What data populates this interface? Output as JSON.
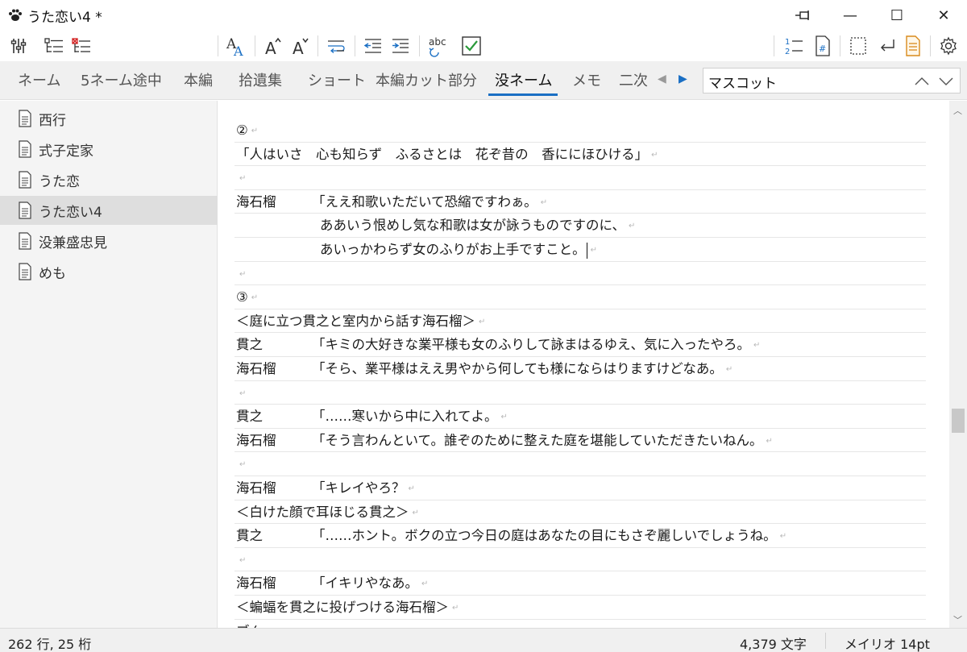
{
  "window": {
    "title": "うた恋い4 *",
    "minimize": "—",
    "maximize": "☐",
    "close": "✕"
  },
  "toolbar": {
    "icons": [
      "settings-tools-icon",
      "outline-view-icon",
      "outline-delete-icon",
      "font-style-icon",
      "font-increase-icon",
      "font-decrease-icon",
      "line-wrap-icon",
      "indent-decrease-icon",
      "indent-increase-icon",
      "spellcheck-icon",
      "check-icon",
      "line-number-icon",
      "page-number-icon",
      "select-box-icon",
      "newline-icon",
      "notes-icon",
      "gear-icon"
    ],
    "font_a": "A",
    "spell_label": "abc"
  },
  "tabs": [
    {
      "label": "ネーム"
    },
    {
      "label": "5ネーム途中"
    },
    {
      "label": "本編"
    },
    {
      "label": "拾遺集"
    },
    {
      "label": "ショート"
    },
    {
      "label": "本編カット部分"
    },
    {
      "label": "没ネーム"
    },
    {
      "label": "メモ"
    },
    {
      "label": "二次"
    }
  ],
  "active_tab": "没ネーム",
  "search": {
    "value": "マスコット"
  },
  "sidebar": {
    "items": [
      {
        "label": "西行"
      },
      {
        "label": "式子定家"
      },
      {
        "label": "うた恋"
      },
      {
        "label": "うた恋い4"
      },
      {
        "label": "没兼盛忠見"
      },
      {
        "label": "めも"
      }
    ],
    "selected": "うた恋い4"
  },
  "editor": {
    "lines": [
      {
        "speaker": "",
        "text": "②"
      },
      {
        "speaker": "",
        "text": "「人はいさ　心も知らず　ふるさとは　花ぞ昔の　香ににほひける」"
      },
      {
        "speaker": "",
        "text": ""
      },
      {
        "speaker": "海石榴",
        "text": "「ええ和歌いただいて恐縮ですわぁ。"
      },
      {
        "speaker": "",
        "text": "ああいう恨めし気な和歌は女が詠うものですのに、",
        "indent": true
      },
      {
        "speaker": "",
        "text": "あいっかわらず女のふりがお上手ですこと。",
        "indent": true,
        "caret": true
      },
      {
        "speaker": "",
        "text": ""
      },
      {
        "speaker": "",
        "text": "③"
      },
      {
        "speaker": "",
        "text": "＜庭に立つ貫之と室内から話す海石榴＞"
      },
      {
        "speaker": "貫之",
        "text": "「キミの大好きな業平様も女のふりして詠まはるゆえ、気に入ったやろ。"
      },
      {
        "speaker": "海石榴",
        "text": "「そら、業平様はええ男やから何しても様にならはりますけどなあ。"
      },
      {
        "speaker": "",
        "text": ""
      },
      {
        "speaker": "貫之",
        "text": "「……寒いから中に入れてよ。"
      },
      {
        "speaker": "海石榴",
        "text": "「そう言わんといて。誰ぞのために整えた庭を堪能していただきたいねん。"
      },
      {
        "speaker": "",
        "text": ""
      },
      {
        "speaker": "海石榴",
        "text": "「キレイやろ？"
      },
      {
        "speaker": "",
        "text": "＜白けた顔で耳ほじる貫之＞"
      },
      {
        "speaker": "貫之",
        "text": "「……ホント。ボクの立つ今日の庭はあなたの目にもさぞ麗しいでしょうね。"
      },
      {
        "speaker": "",
        "text": ""
      },
      {
        "speaker": "海石榴",
        "text": "「イキリやなあ。"
      },
      {
        "speaker": "",
        "text": "＜蝙蝠を貫之に投げつける海石榴＞"
      },
      {
        "speaker": "",
        "text": "ブん"
      }
    ]
  },
  "status": {
    "position": "262 行, 25 桁",
    "char_count": "4,379 文字",
    "font": "メイリオ 14pt"
  }
}
